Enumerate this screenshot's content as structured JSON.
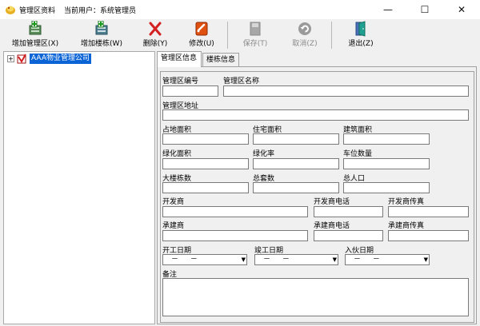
{
  "window": {
    "title": "管理区资料",
    "current_user": "当前用户：系统管理员",
    "minimize": "—",
    "maximize": "☐",
    "close": "✕"
  },
  "toolbar": {
    "add_area": "增加管理区(X)",
    "add_building": "增加楼栋(W)",
    "delete": "删除(Y)",
    "modify": "修改(U)",
    "save": "保存(T)",
    "cancel": "取消(Z)",
    "exit": "退出(Z)"
  },
  "tree": {
    "expander": "+",
    "root_label": "AAA物业管理公司"
  },
  "tabs": [
    "管理区信息",
    "楼栋信息"
  ],
  "form": {
    "area_no": "管理区编号",
    "area_name": "管理区名称",
    "area_address": "管理区地址",
    "land_area": "占地面积",
    "residential_area": "住宅面积",
    "building_area": "建筑面积",
    "green_area": "绿化面积",
    "green_rate": "绿化率",
    "parking_count": "车位数量",
    "large_buildings": "大楼栋数",
    "total_units": "总套数",
    "total_population": "总人口",
    "developer": "开发商",
    "developer_phone": "开发商电话",
    "developer_fax": "开发商传真",
    "contractor": "承建商",
    "contractor_phone": "承建商电话",
    "contractor_fax": "承建商传真",
    "start_date": "开工日期",
    "finish_date": "竣工日期",
    "move_in_date": "入伙日期",
    "remarks": "备注",
    "date_placeholder": "－ －"
  }
}
